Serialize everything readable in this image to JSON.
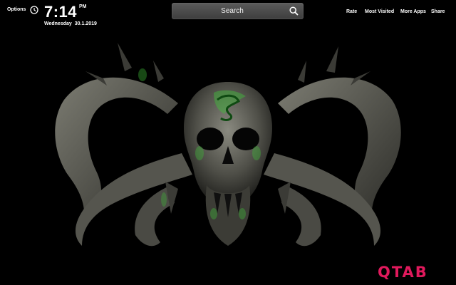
{
  "header": {
    "options_label": "Options",
    "time": "7:14",
    "ampm": "PM",
    "weekday": "Wednesday",
    "date": "30.1.2019",
    "clock_icon": "clock-icon"
  },
  "search": {
    "placeholder": "Search",
    "icon": "search-icon"
  },
  "nav": {
    "rate": "Rate",
    "most_visited": "Most Visited",
    "more_apps": "More Apps",
    "share": "Share"
  },
  "brand": {
    "logo_text": "QTAB",
    "logo_color": "#e0195c"
  },
  "background": {
    "description_colors": {
      "base": "#000000",
      "bone": "#6b6b63",
      "glow": "#3fbf3a"
    }
  }
}
